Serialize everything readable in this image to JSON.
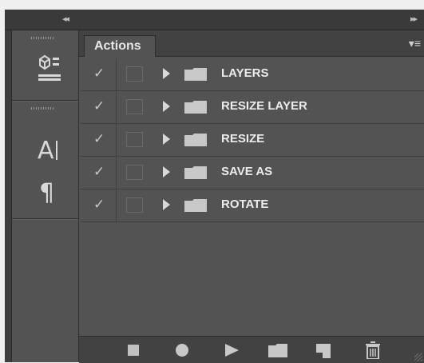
{
  "topbar": {
    "collapse_left_glyph": "◂◂",
    "collapse_right_glyph": "▸▸"
  },
  "dock": {
    "icons": [
      "3d-icon",
      "character-icon",
      "paragraph-icon"
    ],
    "character_glyph": "A",
    "paragraph_glyph": "¶"
  },
  "panel": {
    "tab_label": "Actions",
    "menu_glyph": "▾≡",
    "actions": [
      {
        "label": "LAYERS",
        "enabled": true,
        "expanded": false
      },
      {
        "label": "RESIZE LAYER",
        "enabled": true,
        "expanded": false
      },
      {
        "label": "RESIZE",
        "enabled": true,
        "expanded": false
      },
      {
        "label": "SAVE AS",
        "enabled": true,
        "expanded": false
      },
      {
        "label": "ROTATE",
        "enabled": true,
        "expanded": false
      }
    ],
    "check_glyph": "✓"
  },
  "toolbar": {
    "buttons": [
      "stop-icon",
      "record-icon",
      "play-icon",
      "new-set-icon",
      "new-action-icon",
      "trash-icon"
    ]
  },
  "colors": {
    "panel_bg": "#535353",
    "bar_bg": "#424242",
    "text": "#ececec"
  }
}
